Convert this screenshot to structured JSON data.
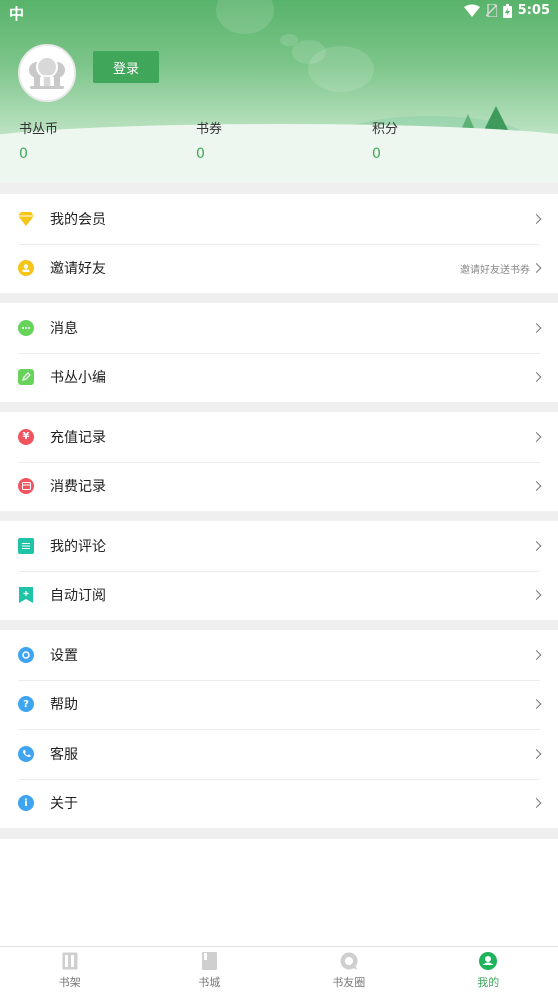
{
  "status_bar": {
    "time": "5:05",
    "carrier_glyph": "中"
  },
  "header": {
    "login_label": "登录",
    "stats": [
      {
        "label": "书丛币",
        "value": "0"
      },
      {
        "label": "书券",
        "value": "0"
      },
      {
        "label": "积分",
        "value": "0"
      }
    ]
  },
  "menu": {
    "groups": [
      [
        {
          "label": "我的会员",
          "icon": "diamond-icon",
          "color": "#f5c518"
        },
        {
          "label": "邀请好友",
          "icon": "coin-icon",
          "color": "#f5c518",
          "hint": "邀请好友送书券"
        }
      ],
      [
        {
          "label": "消息",
          "icon": "chat-icon",
          "color": "#67d35a"
        },
        {
          "label": "书丛小编",
          "icon": "edit-icon",
          "color": "#67d35a"
        }
      ],
      [
        {
          "label": "充值记录",
          "icon": "yen-icon",
          "color": "#f0555f"
        },
        {
          "label": "消费记录",
          "icon": "wallet-icon",
          "color": "#f0555f"
        }
      ],
      [
        {
          "label": "我的评论",
          "icon": "comment-list-icon",
          "color": "#1fc3a7"
        },
        {
          "label": "自动订阅",
          "icon": "bookmark-icon",
          "color": "#1fc3a7"
        }
      ],
      [
        {
          "label": "设置",
          "icon": "gear-icon",
          "color": "#3fa5f0"
        },
        {
          "label": "帮助",
          "icon": "help-icon",
          "color": "#3fa5f0"
        },
        {
          "label": "客服",
          "icon": "phone-icon",
          "color": "#3fa5f0"
        },
        {
          "label": "关于",
          "icon": "info-icon",
          "color": "#3fa5f0"
        }
      ]
    ]
  },
  "tabbar": {
    "tabs": [
      {
        "label": "书架",
        "icon": "bookshelf-icon"
      },
      {
        "label": "书城",
        "icon": "book-store-icon"
      },
      {
        "label": "书友圈",
        "icon": "friends-circle-icon"
      },
      {
        "label": "我的",
        "icon": "profile-icon",
        "active": true
      }
    ]
  },
  "colors": {
    "accent": "#3fa65a",
    "header_top": "#58b36a"
  }
}
